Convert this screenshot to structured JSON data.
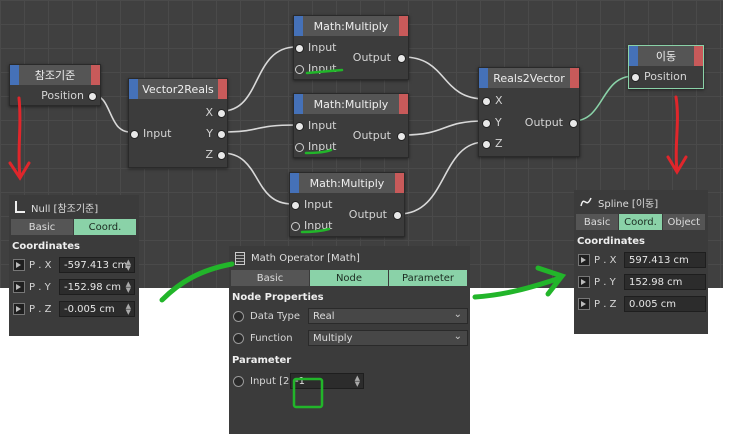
{
  "nodes": {
    "ref": {
      "title": "참조기준",
      "out": "Position"
    },
    "v2r": {
      "title": "Vector2Reals",
      "in": "Input",
      "x": "X",
      "y": "Y",
      "z": "Z"
    },
    "mul1": {
      "title": "Math:Multiply",
      "in1": "Input",
      "in2": "Input",
      "out": "Output"
    },
    "mul2": {
      "title": "Math:Multiply",
      "in1": "Input",
      "in2": "Input",
      "out": "Output"
    },
    "mul3": {
      "title": "Math:Multiply",
      "in1": "Input",
      "in2": "Input",
      "out": "Output"
    },
    "r2v": {
      "title": "Reals2Vector",
      "x": "X",
      "y": "Y",
      "z": "Z",
      "out": "Output"
    },
    "move": {
      "title": "이동",
      "in": "Position"
    }
  },
  "null_panel": {
    "title": "Null [참조기준]",
    "tabs": [
      "Basic",
      "Coord."
    ],
    "section": "Coordinates",
    "rows": [
      {
        "label": "P . X",
        "value": "-597.413 cm"
      },
      {
        "label": "P . Y",
        "value": "-152.98 cm"
      },
      {
        "label": "P . Z",
        "value": "-0.005 cm"
      }
    ]
  },
  "math_panel": {
    "title": "Math Operator [Math]",
    "tabs": [
      "Basic",
      "Node",
      "Parameter"
    ],
    "section1": "Node Properties",
    "datatype_label": "Data Type",
    "datatype_value": "Real",
    "function_label": "Function",
    "function_value": "Multiply",
    "section2": "Parameter",
    "input_label": "Input [2",
    "input_value": "-1"
  },
  "spline_panel": {
    "title": "Spline [이동]",
    "tabs": [
      "Basic",
      "Coord.",
      "Object"
    ],
    "section": "Coordinates",
    "rows": [
      {
        "label": "P . X",
        "value": "597.413 cm"
      },
      {
        "label": "P . Y",
        "value": "152.98 cm"
      },
      {
        "label": "P . Z",
        "value": "0.005 cm"
      }
    ]
  },
  "colors": {
    "accent": "#8ad2a8",
    "wire": "#d9d9d9",
    "wire_out": "#8ad2a8",
    "annotation_red": "#e0262b",
    "annotation_green": "#22b52a"
  }
}
